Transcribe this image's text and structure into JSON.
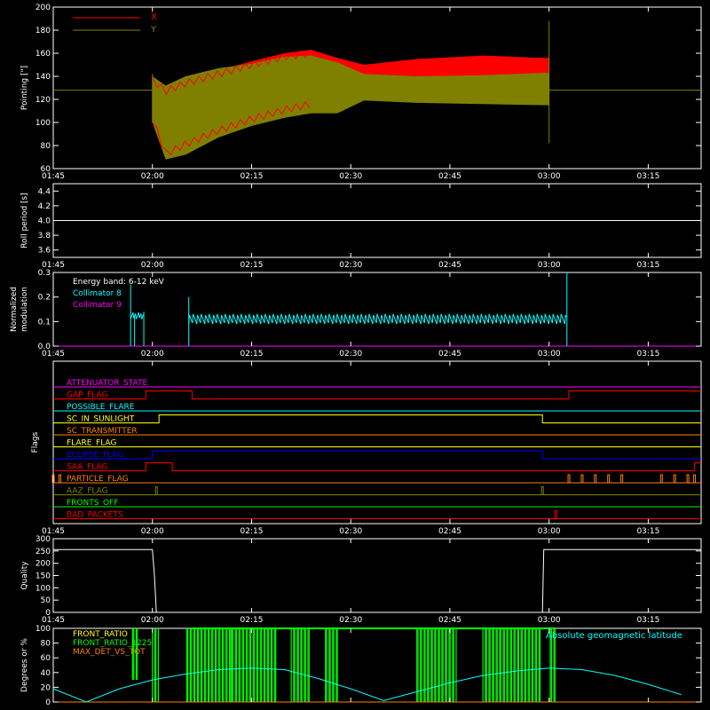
{
  "time_ticks": [
    "01:45",
    "02:00",
    "02:15",
    "02:30",
    "02:45",
    "03:00",
    "03:15"
  ],
  "chart_data": [
    {
      "panel": "pointing",
      "type": "line",
      "ylabel": "Pointing [\"]",
      "ylim": [
        60,
        200
      ],
      "yticks": [
        "60",
        "80",
        "100",
        "120",
        "140",
        "160",
        "180",
        "200"
      ],
      "xlim": [
        "01:45",
        "03:23"
      ],
      "legend": {
        "placement": "top-left"
      },
      "series": [
        {
          "name": "X",
          "color": "#ff0000",
          "envelope": {
            "x": [
              "02:00",
              "02:02",
              "02:05",
              "02:10",
              "02:15",
              "02:20",
              "02:24",
              "02:28",
              "02:32",
              "02:40",
              "02:50",
              "02:59",
              "03:00"
            ],
            "upper": [
              140,
              130,
              137,
              145,
              153,
              160,
              163,
              156,
              150,
              155,
              158,
              156,
              156
            ],
            "lower": [
              100,
              70,
              78,
              90,
              100,
              108,
              113,
              118,
              123,
              118,
              117,
              117,
              117
            ]
          }
        },
        {
          "name": "Y",
          "color": "#808000",
          "envelope": {
            "x": [
              "02:00",
              "02:02",
              "02:05",
              "02:10",
              "02:15",
              "02:20",
              "02:24",
              "02:28",
              "02:32",
              "02:40",
              "02:50",
              "02:59",
              "03:00"
            ],
            "upper": [
              140,
              132,
              140,
              147,
              151,
              157,
              158,
              152,
              142,
              140,
              141,
              143,
              143
            ],
            "lower": [
              100,
              68,
              72,
              87,
              97,
              104,
              108,
              108,
              119,
              117,
              116,
              115,
              115
            ]
          },
          "baseline": 128
        }
      ]
    },
    {
      "panel": "roll",
      "type": "line",
      "ylabel": "Roll period [s]",
      "ylim": [
        3.5,
        4.5
      ],
      "yticks": [
        "3.6",
        "3.8",
        "4.0",
        "4.2",
        "4.4"
      ],
      "series": [
        {
          "name": "",
          "color": "#ffffff",
          "x": [
            "01:45",
            "03:23"
          ],
          "y": [
            4.0,
            4.0
          ]
        }
      ]
    },
    {
      "panel": "modulation",
      "type": "line",
      "ylabel": [
        "Normalized",
        "modulation"
      ],
      "ylim": [
        0.0,
        0.3
      ],
      "yticks": [
        "0.0",
        "0.1",
        "0.2",
        "0.3"
      ],
      "title": "Energy band: 6-12 keV",
      "series": [
        {
          "name": "Collimator 8",
          "color": "#00ffff",
          "segments": [
            {
              "x": [
                "01:56.7",
                "01:56.8",
                "01:57.0",
                "01:58.5",
                "01:58.7"
              ],
              "y": [
                0.12,
                0.25,
                0.12,
                0.12,
                0.14
              ]
            },
            {
              "x": [
                "02:05.5",
                "02:05.7",
                "02:06.0",
                "03:02.5",
                "03:02.7"
              ],
              "y": [
                0.2,
                0.12,
                0.11,
                0.11,
                0.13
              ]
            }
          ],
          "spike": {
            "x": "03:02.7",
            "y": 0.3
          },
          "mean": 0.11
        },
        {
          "name": "Collimator 9",
          "color": "#ff00ff",
          "x": [
            "01:45",
            "03:23"
          ],
          "y": [
            0.0,
            0.0
          ]
        }
      ]
    },
    {
      "panel": "flags",
      "type": "line",
      "ylabel": "Flags",
      "series": [
        {
          "name": "ATTENUATOR_STATE",
          "color": "#ff00ff",
          "steps": [
            [
              "01:45",
              0
            ]
          ]
        },
        {
          "name": "GAP_FLAG",
          "color": "#ff0000",
          "steps": [
            [
              "01:45",
              0
            ],
            [
              "01:59",
              1
            ],
            [
              "02:06",
              0
            ],
            [
              "03:03",
              1
            ]
          ]
        },
        {
          "name": "POSSIBLE_FLARE",
          "color": "#00ffff",
          "steps": [
            [
              "01:45",
              0
            ]
          ]
        },
        {
          "name": "SC_IN_SUNLIGHT",
          "color": "#ffff00",
          "steps": [
            [
              "01:45",
              0
            ],
            [
              "02:01",
              1
            ],
            [
              "02:59",
              0
            ]
          ]
        },
        {
          "name": "SC_TRANSMITTER",
          "color": "#ff8000",
          "steps": [
            [
              "01:45",
              0
            ]
          ]
        },
        {
          "name": "FLARE_FLAG",
          "color": "#ffff00",
          "steps": [
            [
              "01:45",
              0
            ]
          ]
        },
        {
          "name": "ECLIPSE_FLAG",
          "color": "#0000ff",
          "steps": [
            [
              "01:45",
              0
            ],
            [
              "02:00",
              1
            ],
            [
              "02:59",
              0
            ]
          ]
        },
        {
          "name": "SAA_FLAG",
          "color": "#ff0000",
          "steps": [
            [
              "01:45",
              0
            ],
            [
              "01:59",
              1
            ],
            [
              "02:03",
              0
            ],
            [
              "03:22",
              1
            ]
          ]
        },
        {
          "name": "PARTICLE_FLAG",
          "color": "#ff8000",
          "steps": [
            [
              "01:45",
              0
            ]
          ],
          "pulses": [
            "01:45",
            "01:46",
            "03:03",
            "03:05",
            "03:07",
            "03:09",
            "03:11",
            "03:17",
            "03:19",
            "03:21",
            "03:22"
          ]
        },
        {
          "name": "AAZ_FLAG",
          "color": "#808000",
          "steps": [
            [
              "01:45",
              0
            ]
          ],
          "pulses": [
            "02:00.6",
            "02:59"
          ]
        },
        {
          "name": "FRONTS_OFF",
          "color": "#00ff00",
          "steps": [
            [
              "01:45",
              0
            ]
          ]
        },
        {
          "name": "BAD_PACKETS",
          "color": "#ff0000",
          "steps": [
            [
              "01:45",
              0
            ]
          ],
          "pulses": [
            "03:01"
          ]
        }
      ]
    },
    {
      "panel": "quality",
      "type": "line",
      "ylabel": "Quality",
      "ylim": [
        0,
        300
      ],
      "yticks": [
        "0",
        "50",
        "100",
        "150",
        "200",
        "250",
        "300"
      ],
      "series": [
        {
          "name": "",
          "color": "#ffffff",
          "x": [
            "01:45",
            "02:00",
            "02:00.3",
            "02:00.6",
            "02:59",
            "02:59.2",
            "03:23"
          ],
          "y": [
            256,
            256,
            150,
            0,
            0,
            256,
            256
          ]
        }
      ]
    },
    {
      "panel": "ratios",
      "type": "line",
      "ylabel": "Degrees or %",
      "ylim": [
        0,
        100
      ],
      "yticks": [
        "0",
        "20",
        "40",
        "60",
        "80",
        "100"
      ],
      "series": [
        {
          "name": "FRONT_RATIO",
          "color": "#ffff00"
        },
        {
          "name": "FRONT_RATIO_1225",
          "color": "#00ff00",
          "bursts": [
            [
              "01:57",
              "01:58",
              30,
              100
            ],
            [
              "02:00",
              "02:01",
              0,
              100
            ],
            [
              "02:05",
              "02:12",
              0,
              100
            ],
            [
              "02:12",
              "02:19",
              0,
              100
            ],
            [
              "02:21",
              "02:24",
              0,
              100
            ],
            [
              "02:26",
              "02:28",
              0,
              100
            ],
            [
              "02:40",
              "02:46",
              0,
              100
            ],
            [
              "02:50",
              "02:59",
              0,
              100
            ],
            [
              "03:00",
              "03:01",
              0,
              100
            ]
          ]
        },
        {
          "name": "MAX_DET_VS_TOT",
          "color": "#ff8000",
          "x": [
            "01:45",
            "03:23"
          ],
          "y": [
            0,
            0
          ]
        },
        {
          "name": "Absolute geomagnetic latitude",
          "color": "#00ffff",
          "x": [
            "01:45",
            "01:50",
            "01:55",
            "02:00",
            "02:05",
            "02:10",
            "02:15",
            "02:20",
            "02:25",
            "02:30",
            "02:35",
            "02:40",
            "02:45",
            "02:50",
            "02:55",
            "03:00",
            "03:05",
            "03:10",
            "03:15",
            "03:20"
          ],
          "y": [
            18,
            0,
            18,
            30,
            38,
            44,
            46,
            44,
            32,
            18,
            2,
            14,
            26,
            36,
            42,
            46,
            44,
            36,
            24,
            10
          ]
        }
      ]
    }
  ]
}
